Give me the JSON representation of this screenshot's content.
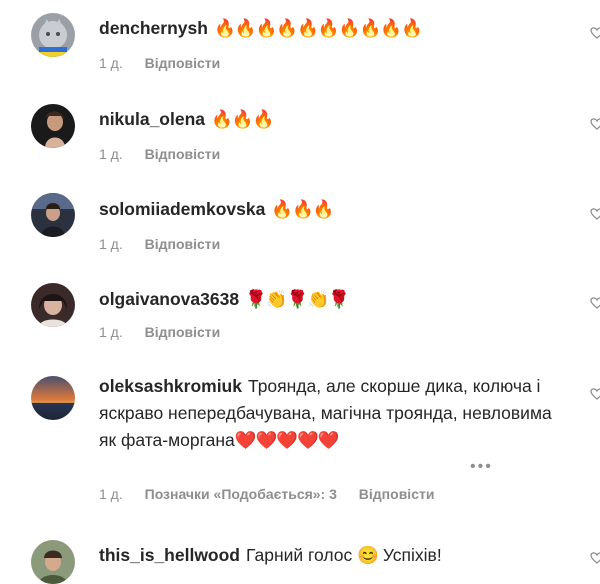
{
  "comments": [
    {
      "username": "denchernysh",
      "text": "",
      "emoji": "🔥🔥🔥🔥🔥🔥🔥🔥🔥🔥",
      "time": "1 д.",
      "reply": "Відповісти",
      "avatar_icon": "cat-avatar-icon"
    },
    {
      "username": "nikula_olena",
      "text": "",
      "emoji": "🔥🔥🔥",
      "time": "1 д.",
      "reply": "Відповісти",
      "avatar_icon": "person-avatar-icon"
    },
    {
      "username": "solomiiademkovska",
      "text": "",
      "emoji": "🔥🔥🔥",
      "time": "1 д.",
      "reply": "Відповісти",
      "avatar_icon": "person-avatar-icon"
    },
    {
      "username": "olgaivanova3638",
      "text": "",
      "emoji": "🌹👏🌹👏🌹",
      "time": "1 д.",
      "reply": "Відповісти",
      "avatar_icon": "person-avatar-icon"
    },
    {
      "username": "oleksashkromiuk",
      "text": "Троянда, але скорше дика, колюча і яскраво непередбачувана, магічна троянда, невловима як фата-моргана",
      "emoji": "❤️❤️❤️❤️❤️",
      "time": "1 д.",
      "likes": "Позначки «Подобається»: 3",
      "reply": "Відповісти",
      "more": "•••",
      "avatar_icon": "sunset-avatar-icon"
    },
    {
      "username": "this_is_hellwood",
      "text": "Гарний голос",
      "emoji": "😊",
      "text_after": "Успіхів!",
      "avatar_icon": "person-avatar-icon"
    }
  ],
  "colors": {
    "text": "#262626",
    "secondary": "#8e8e8e",
    "background": "#ffffff"
  }
}
